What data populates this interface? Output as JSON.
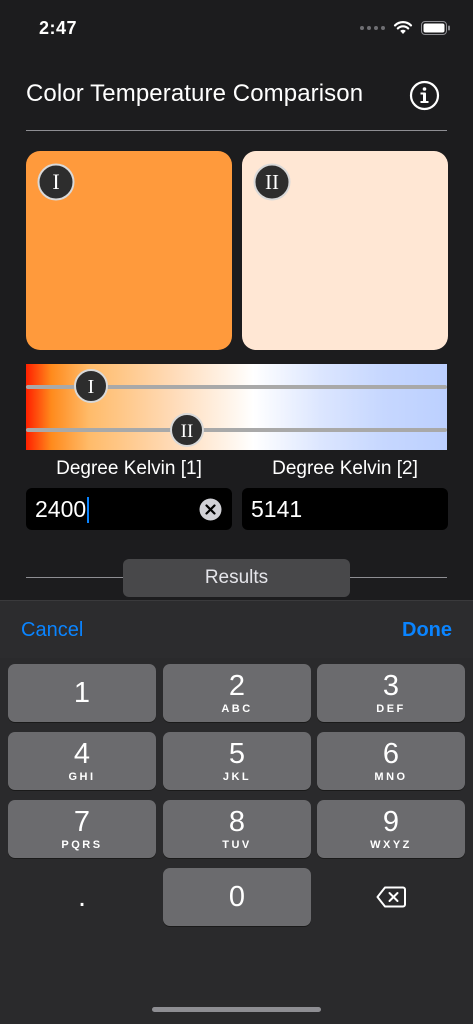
{
  "status": {
    "time": "2:47",
    "icons": [
      "signal-dots-icon",
      "wifi-icon",
      "battery-icon"
    ]
  },
  "header": {
    "title": "Color Temperature Comparison",
    "info_icon": "info-circle-icon"
  },
  "swatches": [
    {
      "badge": "I",
      "color": "#ff9a3c"
    },
    {
      "badge": "II",
      "color": "#ffe7d4"
    }
  ],
  "slider": {
    "thumbs": [
      "I",
      "II"
    ]
  },
  "fields": [
    {
      "label": "Degree Kelvin [1]",
      "value": "2400"
    },
    {
      "label": "Degree Kelvin [2]",
      "value": "5141"
    }
  ],
  "results": {
    "label": "Results"
  },
  "keyboard": {
    "cancel": "Cancel",
    "done": "Done",
    "keys": [
      {
        "digit": "1",
        "letters": ""
      },
      {
        "digit": "2",
        "letters": "ABC"
      },
      {
        "digit": "3",
        "letters": "DEF"
      },
      {
        "digit": "4",
        "letters": "GHI"
      },
      {
        "digit": "5",
        "letters": "JKL"
      },
      {
        "digit": "6",
        "letters": "MNO"
      },
      {
        "digit": "7",
        "letters": "PQRS"
      },
      {
        "digit": "8",
        "letters": "TUV"
      },
      {
        "digit": "9",
        "letters": "WXYZ"
      },
      {
        "digit": "."
      },
      {
        "digit": "0"
      }
    ],
    "delete_icon": "backspace-icon"
  },
  "colors": {
    "accent": "#0a84ff",
    "background": "#1c1c1e",
    "key": "#6b6b6e"
  }
}
